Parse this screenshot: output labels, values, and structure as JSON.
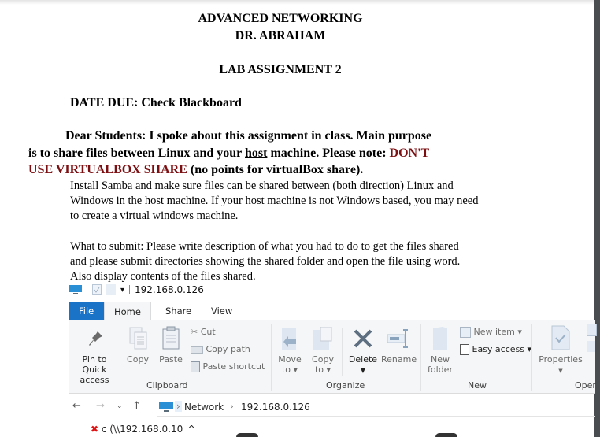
{
  "document": {
    "course": "ADVANCED NETWORKING",
    "instructor": "DR. ABRAHAM",
    "assignment": "LAB ASSIGNMENT 2",
    "date_due": "DATE DUE: Check Blackboard",
    "intro_line1": "Dear Students:  I spoke about this assignment in class.  Main purpose",
    "intro_line2_a": "is to share files between Linux and your ",
    "intro_line2_host": "host",
    "intro_line2_b": " machine. Please note: ",
    "intro_line2_red": "DON'T",
    "intro_line3_red": "USE VIRTUALBOX SHARE",
    "intro_line3_b": " (no points for virtualBox share).",
    "para1": [
      "Install Samba and make sure files can be shared between (both direction) Linux and",
      "Windows in the host machine. If your host machine is not Windows based, you may need",
      "to create a virtual windows machine."
    ],
    "para2": [
      "What to submit:  Please write description of what you had to do to get the files shared",
      "and please submit directories showing the shared folder and open the file using word.",
      "Also display contents of the files shared."
    ],
    "colors": {
      "warning_red": "#7b0f12"
    }
  },
  "explorer": {
    "window_title": "192.168.0.126",
    "tabs": [
      "File",
      "Home",
      "Share",
      "View"
    ],
    "active_tab": "Home",
    "accent": "#1a73c7",
    "clipboard": {
      "label": "Clipboard",
      "pin_line1": "Pin to Quick",
      "pin_line2": "access",
      "copy": "Copy",
      "paste": "Paste",
      "cut": "Cut",
      "copy_path": "Copy path",
      "paste_shortcut": "Paste shortcut"
    },
    "organize": {
      "label": "Organize",
      "move_to_1": "Move",
      "move_to_2": "to ▾",
      "copy_to_1": "Copy",
      "copy_to_2": "to ▾",
      "delete": "Delete",
      "rename": "Rename"
    },
    "new": {
      "label": "New",
      "new_folder_1": "New",
      "new_folder_2": "folder",
      "new_item": "New item ▾",
      "easy_access": "Easy access ▾"
    },
    "open": {
      "label": "Oper",
      "properties": "Properties"
    },
    "address": {
      "crumbs": [
        "Network",
        "192.168.0.126"
      ]
    },
    "nav_pane": {
      "item": "c (\\\\192.168.0.10"
    }
  }
}
